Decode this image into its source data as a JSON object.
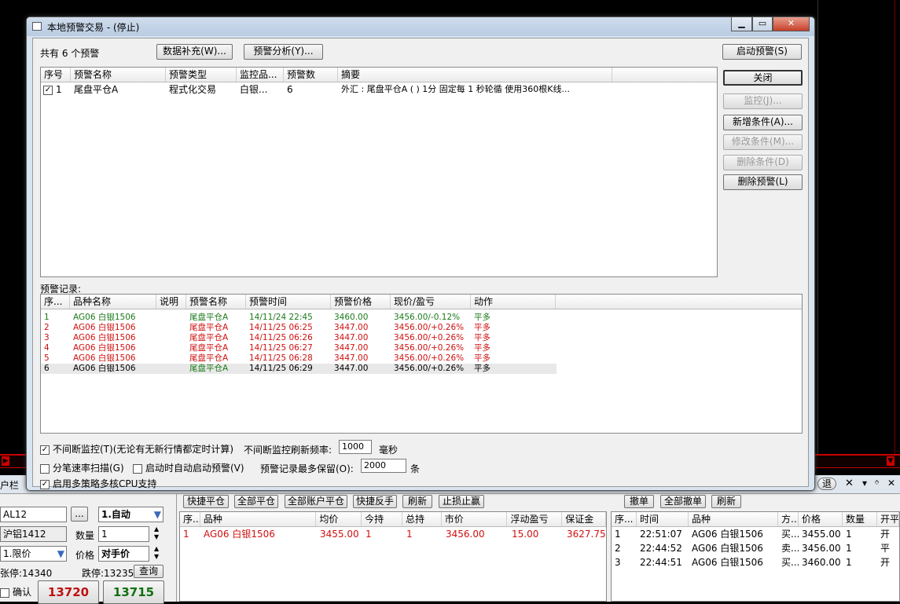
{
  "dialog": {
    "title": "本地预警交易 - (停止)",
    "count_label": "共有 6 个预警",
    "btn_data_supplement": "数据补充(W)...",
    "btn_analysis": "预警分析(Y)...",
    "side_buttons": {
      "start": "启动预警(S)",
      "close": "关闭",
      "monitor": "监控(J)...",
      "add": "新增条件(A)...",
      "modify": "修改条件(M)...",
      "delete_cond": "删除条件(D)",
      "delete_alert": "删除预警(L)"
    },
    "alerts_table": {
      "headers": [
        "序号",
        "预警名称",
        "预警类型",
        "监控品...",
        "预警数",
        "摘要"
      ],
      "rows": [
        {
          "no": "1",
          "name": "尾盘平仓A",
          "type": "程式化交易",
          "item": "白银...",
          "count": "6",
          "summary": "外汇 : 尾盘平仓A ( ) 1分 固定每 1 秒轮循 使用360根K线..."
        }
      ]
    },
    "records_label": "预警记录:",
    "records_table": {
      "headers": [
        "序...",
        "品种名称",
        "说明",
        "预警名称",
        "预警时间",
        "预警价格",
        "现价/盈亏",
        "动作"
      ],
      "rows": [
        {
          "no": "1",
          "item": "AG06 白银1506",
          "note": "",
          "name": "尾盘平仓A",
          "time": "14/11/24 22:45",
          "price": "3460.00",
          "pl": "3456.00/-0.12%",
          "action": "平多",
          "color": "green"
        },
        {
          "no": "2",
          "item": "AG06 白银1506",
          "note": "",
          "name": "尾盘平仓A",
          "time": "14/11/25 06:25",
          "price": "3447.00",
          "pl": "3456.00/+0.26%",
          "action": "平多",
          "color": "red"
        },
        {
          "no": "3",
          "item": "AG06 白银1506",
          "note": "",
          "name": "尾盘平仓A",
          "time": "14/11/25 06:26",
          "price": "3447.00",
          "pl": "3456.00/+0.26%",
          "action": "平多",
          "color": "red"
        },
        {
          "no": "4",
          "item": "AG06 白银1506",
          "note": "",
          "name": "尾盘平仓A",
          "time": "14/11/25 06:27",
          "price": "3447.00",
          "pl": "3456.00/+0.26%",
          "action": "平多",
          "color": "red"
        },
        {
          "no": "5",
          "item": "AG06 白银1506",
          "note": "",
          "name": "尾盘平仓A",
          "time": "14/11/25 06:28",
          "price": "3447.00",
          "pl": "3456.00/+0.26%",
          "action": "平多",
          "color": "red"
        },
        {
          "no": "6",
          "item": "AG06 白银1506",
          "note": "",
          "name": "尾盘平仓A",
          "time": "14/11/25 06:29",
          "price": "3447.00",
          "pl": "3456.00/+0.26%",
          "action": "平多",
          "color": "black"
        }
      ]
    },
    "options": {
      "continuous_monitor": "不间断监控(T)(无论有无新行情都定时计算)",
      "refresh_label": "不间断监控刷新频率:",
      "refresh_value": "1000",
      "refresh_unit": "毫秒",
      "tick_scan": "分笔速率扫描(G)",
      "auto_start": "启动时自动启动预警(V)",
      "keep_label": "预警记录最多保留(O):",
      "keep_value": "2000",
      "keep_unit": "条",
      "multi_cpu": "启用多策略多核CPU支持"
    }
  },
  "bottom": {
    "left_partial": "户栏",
    "order": {
      "code": "AL12",
      "code_btn": "...",
      "mode": "1.自动",
      "name": "沪铝1412",
      "qty_label": "数量",
      "qty": "1",
      "order_type": "1.限价",
      "price_label": "价格",
      "price": "对手价",
      "limit_up": "张停:14340",
      "limit_down": "跌停:13235",
      "query_btn": "查询",
      "confirm_label": "确认",
      "bid": "13720",
      "ask": "13715"
    },
    "position_buttons": [
      "快捷平仓",
      "全部平仓",
      "全部账户平仓",
      "快捷反手",
      "刷新",
      "止损止赢"
    ],
    "position_headers": [
      "序...",
      "品种",
      "均价",
      "今持",
      "总持",
      "市价",
      "浮动盈亏",
      "保证金"
    ],
    "positions": [
      {
        "no": "1",
        "item": "AG06 白银1506",
        "avg": "3455.00",
        "today": "1",
        "total": "1",
        "market": "3456.00",
        "float_pl": "15.00",
        "margin": "3627.75"
      }
    ],
    "order_buttons": [
      "撤单",
      "全部撤单",
      "刷新"
    ],
    "order_headers": [
      "序...",
      "时间",
      "品种",
      "方...",
      "价格",
      "数量",
      "开平"
    ],
    "orders": [
      {
        "no": "1",
        "time": "22:51:07",
        "item": "AG06 白银1506",
        "dir": "买...",
        "price": "3455.00",
        "qty": "1",
        "oc": "开"
      },
      {
        "no": "2",
        "time": "22:44:52",
        "item": "AG06 白银1506",
        "dir": "卖...",
        "price": "3456.00",
        "qty": "1",
        "oc": "平"
      },
      {
        "no": "3",
        "time": "22:44:51",
        "item": "AG06 白银1506",
        "dir": "买...",
        "price": "3460.00",
        "qty": "1",
        "oc": "开"
      }
    ],
    "toolbar_exit": "退"
  }
}
